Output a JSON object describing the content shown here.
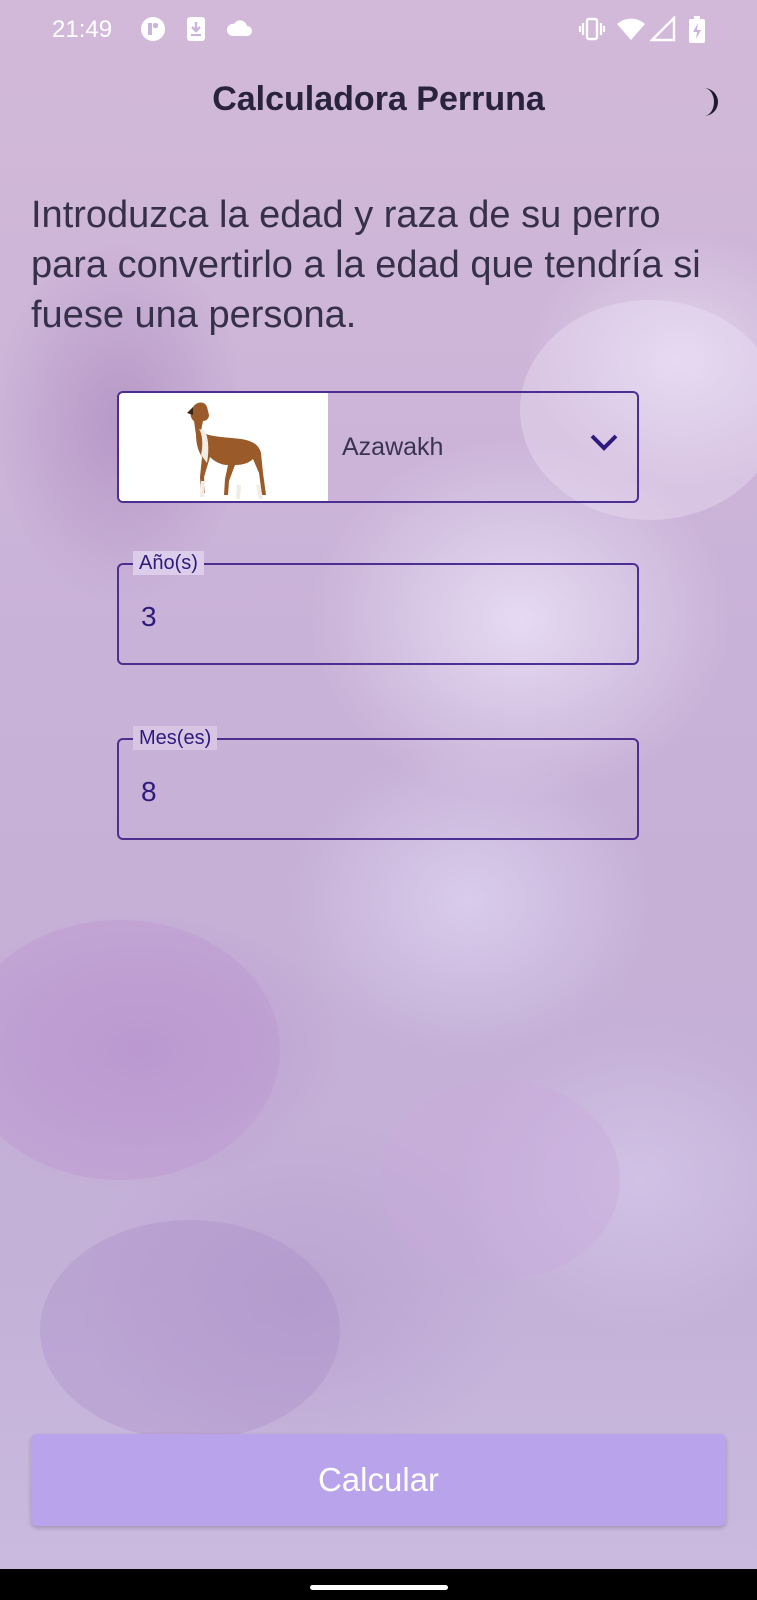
{
  "status_bar": {
    "time": "21:49",
    "left_icons": [
      "app-badge-icon",
      "download-icon",
      "cloud-icon"
    ],
    "right_icons": [
      "vibrate-icon",
      "wifi-icon",
      "signal-icon",
      "battery-charging-icon"
    ]
  },
  "header": {
    "title": "Calculadora Perruna",
    "theme_icon": "moon-icon"
  },
  "intro_text": "Introduzca la edad y raza de su perro para convertirlo a la edad que tendría si fuese una persona.",
  "breed_select": {
    "selected": "Azawakh",
    "image": "dog-photo",
    "icon": "chevron-down-icon"
  },
  "years_field": {
    "label": "Año(s)",
    "value": "3"
  },
  "months_field": {
    "label": "Mes(es)",
    "value": "8"
  },
  "calculate_button": {
    "label": "Calcular"
  },
  "colors": {
    "accent": "#4d2f91",
    "button": "#b9a4ec",
    "title_text": "#2a2340"
  }
}
